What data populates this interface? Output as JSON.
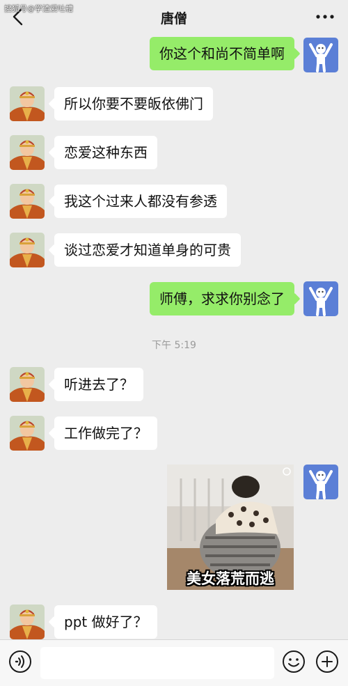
{
  "watermark": "搜狐号@学渣爱吐槽",
  "header": {
    "title": "唐僧",
    "back_icon": "chevron-left-icon",
    "more_icon": "more-dots-icon"
  },
  "messages": [
    {
      "side": "out",
      "text": "你这个和尚不简单啊"
    },
    {
      "side": "in",
      "text": "所以你要不要皈依佛门"
    },
    {
      "side": "in",
      "text": "恋爱这种东西"
    },
    {
      "side": "in",
      "text": "我这个过来人都没有参透"
    },
    {
      "side": "in",
      "text": "谈过恋爱才知道单身的可贵"
    },
    {
      "side": "out",
      "text": "师傅，求求你别念了"
    },
    {
      "side": "in",
      "text": "听进去了？"
    },
    {
      "side": "in",
      "text": "工作做完了？"
    },
    {
      "side": "out",
      "type": "sticker",
      "caption": "美女落荒而逃"
    },
    {
      "side": "in",
      "text": "ppt 做好了？"
    }
  ],
  "timestamp": "下午 5:19",
  "input_bar": {
    "voice_icon": "voice-icon",
    "input_value": "",
    "emoji_icon": "emoji-icon",
    "plus_icon": "plus-icon"
  },
  "colors": {
    "background": "#ededed",
    "bubble_out": "#95ec69",
    "bubble_in": "#ffffff",
    "self_avatar": "#5b7fd6"
  }
}
